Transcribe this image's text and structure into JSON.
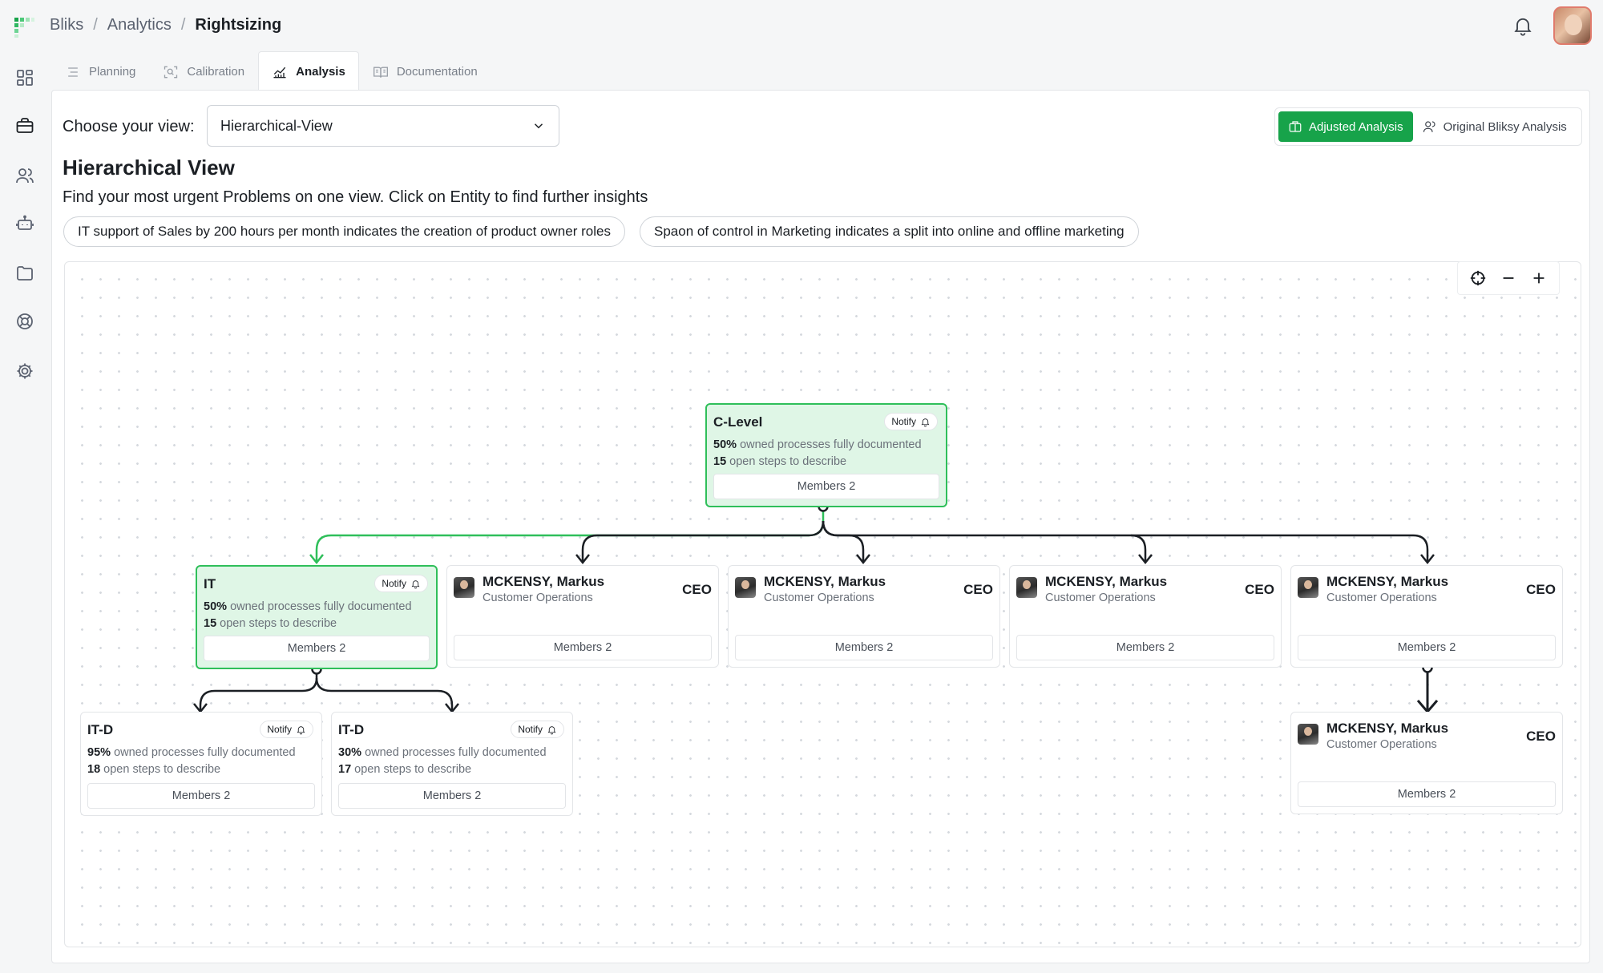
{
  "breadcrumbs": [
    "Bliks",
    "Analytics",
    "Rightsizing"
  ],
  "tabs": [
    {
      "label": "Planning",
      "icon": "list-icon"
    },
    {
      "label": "Calibration",
      "icon": "scan-search-icon"
    },
    {
      "label": "Analysis",
      "icon": "chart-icon",
      "active": true
    },
    {
      "label": "Documentation",
      "icon": "book-icon"
    }
  ],
  "view": {
    "label": "Choose your view:",
    "selected": "Hierarchical-View"
  },
  "analysis_toggle": {
    "adjusted": "Adjusted Analysis",
    "original": "Original Bliksy Analysis"
  },
  "heading": {
    "title": "Hierarchical View",
    "subtitle": "Find your most urgent Problems on one view. Click on Entity to find further insights"
  },
  "insights": [
    "IT support of Sales by 200 hours per month indicates the creation of product owner roles",
    "Spaon of control in Marketing indicates a split into online and offline marketing"
  ],
  "colors": {
    "accent": "#17a34a",
    "node_highlight_bg": "#dff6e6",
    "node_highlight_border": "#2fbf5a"
  },
  "nodes": {
    "clevel": {
      "title": "C-Level",
      "notify": "Notify",
      "pct": "50%",
      "pct_text": "owned processes fully documented",
      "steps": "15",
      "steps_text": "open steps to describe",
      "members": "Members 2"
    },
    "it": {
      "title": "IT",
      "notify": "Notify",
      "pct": "50%",
      "pct_text": "owned processes fully documented",
      "steps": "15",
      "steps_text": "open steps to describe",
      "members": "Members 2"
    },
    "itd1": {
      "title": "IT-D",
      "notify": "Notify",
      "pct": "95%",
      "pct_text": "owned processes fully documented",
      "steps": "18",
      "steps_text": "open steps to describe",
      "members": "Members 2"
    },
    "itd2": {
      "title": "IT-D",
      "notify": "Notify",
      "pct": "30%",
      "pct_text": "owned processes fully documented",
      "steps": "17",
      "steps_text": "open steps to describe",
      "members": "Members 2"
    },
    "person1": {
      "name": "MCKENSY, Markus",
      "dept": "Customer Operations",
      "role": "CEO",
      "members": "Members 2"
    },
    "person2": {
      "name": "MCKENSY, Markus",
      "dept": "Customer Operations",
      "role": "CEO",
      "members": "Members 2"
    },
    "person3": {
      "name": "MCKENSY, Markus",
      "dept": "Customer Operations",
      "role": "CEO",
      "members": "Members 2"
    },
    "person4": {
      "name": "MCKENSY, Markus",
      "dept": "Customer Operations",
      "role": "CEO",
      "members": "Members 2"
    },
    "person5": {
      "name": "MCKENSY, Markus",
      "dept": "Customer Operations",
      "role": "CEO",
      "members": "Members 2"
    }
  }
}
